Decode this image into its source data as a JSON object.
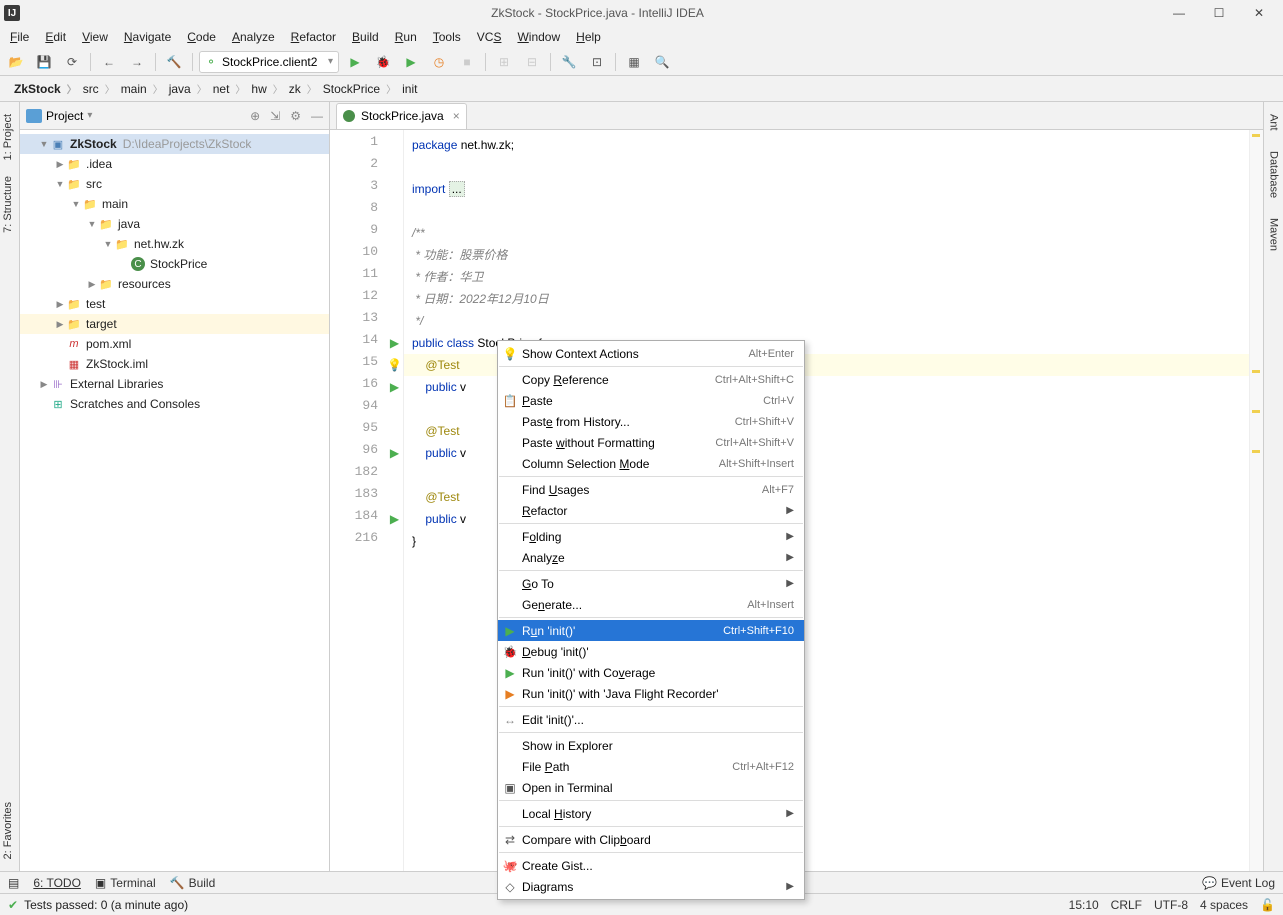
{
  "window": {
    "title": "ZkStock - StockPrice.java - IntelliJ IDEA"
  },
  "menu": [
    "File",
    "Edit",
    "View",
    "Navigate",
    "Code",
    "Analyze",
    "Refactor",
    "Build",
    "Run",
    "Tools",
    "VCS",
    "Window",
    "Help"
  ],
  "menu_u": [
    "F",
    "E",
    "V",
    "N",
    "C",
    "A",
    "R",
    "B",
    "R",
    "T",
    "S",
    "W",
    "H"
  ],
  "run_config": "StockPrice.client2",
  "breadcrumbs": [
    "ZkStock",
    "src",
    "main",
    "java",
    "net",
    "hw",
    "zk",
    "StockPrice",
    "init"
  ],
  "project_panel": {
    "title": "Project"
  },
  "tree": [
    {
      "indent": 0,
      "arrow": "▼",
      "icon": "module",
      "label": "ZkStock",
      "bold": true,
      "path": "D:\\IdeaProjects\\ZkStock",
      "selected": true
    },
    {
      "indent": 1,
      "arrow": "▶",
      "icon": "folder",
      "label": ".idea"
    },
    {
      "indent": 1,
      "arrow": "▼",
      "icon": "folder",
      "label": "src"
    },
    {
      "indent": 2,
      "arrow": "▼",
      "icon": "folder",
      "label": "main"
    },
    {
      "indent": 3,
      "arrow": "▼",
      "icon": "src-folder",
      "label": "java"
    },
    {
      "indent": 4,
      "arrow": "▼",
      "icon": "pkg",
      "label": "net.hw.zk"
    },
    {
      "indent": 5,
      "arrow": "",
      "icon": "class",
      "label": "StockPrice"
    },
    {
      "indent": 3,
      "arrow": "▶",
      "icon": "res",
      "label": "resources"
    },
    {
      "indent": 1,
      "arrow": "▶",
      "icon": "folder",
      "label": "test"
    },
    {
      "indent": 1,
      "arrow": "▶",
      "icon": "target",
      "label": "target",
      "target": true
    },
    {
      "indent": 1,
      "arrow": "",
      "icon": "maven",
      "label": "pom.xml"
    },
    {
      "indent": 1,
      "arrow": "",
      "icon": "iml",
      "label": "ZkStock.iml"
    },
    {
      "indent": 0,
      "arrow": "▶",
      "icon": "ext",
      "label": "External Libraries"
    },
    {
      "indent": 0,
      "arrow": "",
      "icon": "scr",
      "label": "Scratches and Consoles"
    }
  ],
  "tab": {
    "title": "StockPrice.java"
  },
  "code": {
    "line_numbers": [
      "1",
      "2",
      "3",
      "8",
      "9",
      "10",
      "11",
      "12",
      "13",
      "14",
      "15",
      "16",
      "94",
      "95",
      "96",
      "182",
      "183",
      "184",
      "216"
    ],
    "lines": [
      {
        "html": "<span class='kw'>package</span> net.hw.zk;"
      },
      {
        "html": ""
      },
      {
        "html": "<span class='kw'>import</span> <span class='fold-bg'>...</span>"
      },
      {
        "html": ""
      },
      {
        "html": "<span class='cm'>/**</span>"
      },
      {
        "html": "<span class='cm'> * 功能：股票价格</span>"
      },
      {
        "html": "<span class='cm'> * 作者：华卫</span>"
      },
      {
        "html": "<span class='cm'> * 日期：2022年12月10日</span>"
      },
      {
        "html": "<span class='cm'> */</span>"
      },
      {
        "html": "<span class='kw'>public class</span> StockPrice {"
      },
      {
        "html": "    <span class='an'>@Test</span>",
        "hl": true
      },
      {
        "html": "    <span class='kw'>public</span> v"
      },
      {
        "html": ""
      },
      {
        "html": "    <span class='an'>@Test</span>"
      },
      {
        "html": "    <span class='kw'>public</span> v"
      },
      {
        "html": ""
      },
      {
        "html": "    <span class='an'>@Test</span>"
      },
      {
        "html": "    <span class='kw'>public</span> v"
      },
      {
        "html": "}"
      }
    ],
    "gutter_icons": {
      "2": "",
      "9": "run",
      "10": "bulb",
      "11": {
        "type": "run",
        "extra": "↓"
      },
      "14": "run",
      "17": "run"
    }
  },
  "context_menu": [
    {
      "icon": "💡",
      "label": "Show Context Actions",
      "short": "Alt+Enter"
    },
    {
      "sep": true
    },
    {
      "label": "Copy <u>R</u>eference",
      "short": "Ctrl+Alt+Shift+C"
    },
    {
      "icon": "📋",
      "label": "<u>P</u>aste",
      "short": "Ctrl+V"
    },
    {
      "label": "Past<u>e</u> from History...",
      "short": "Ctrl+Shift+V"
    },
    {
      "label": "Paste <u>w</u>ithout Formatting",
      "short": "Ctrl+Alt+Shift+V"
    },
    {
      "label": "Column Selection <u>M</u>ode",
      "short": "Alt+Shift+Insert"
    },
    {
      "sep": true
    },
    {
      "label": "Find <u>U</u>sages",
      "short": "Alt+F7"
    },
    {
      "label": "<u>R</u>efactor",
      "arrow": true
    },
    {
      "sep": true
    },
    {
      "label": "F<u>o</u>lding",
      "arrow": true
    },
    {
      "label": "Analy<u>z</u>e",
      "arrow": true
    },
    {
      "sep": true
    },
    {
      "label": "<u>G</u>o To",
      "arrow": true
    },
    {
      "label": "Ge<u>n</u>erate...",
      "short": "Alt+Insert"
    },
    {
      "sep": true
    },
    {
      "icon": "▶",
      "iconColor": "#4caf50",
      "label": "R<u>u</u>n 'init()'",
      "short": "Ctrl+Shift+F10",
      "selected": true
    },
    {
      "icon": "🐞",
      "iconColor": "#4caf50",
      "label": "<u>D</u>ebug 'init()'"
    },
    {
      "icon": "▶",
      "iconColor": "#4caf50",
      "label": "Run 'init()' with Co<u>v</u>erage"
    },
    {
      "icon": "▶",
      "iconColor": "#e67e22",
      "label": "Run 'init()' with 'Java Flight Recorder'"
    },
    {
      "sep": true
    },
    {
      "icon": "↔",
      "iconColor": "#888",
      "label": "Edit 'init()'..."
    },
    {
      "sep": true
    },
    {
      "label": "Show in Explorer"
    },
    {
      "label": "File <u>P</u>ath",
      "short": "Ctrl+Alt+F12"
    },
    {
      "icon": "▣",
      "label": "Open in Terminal"
    },
    {
      "sep": true
    },
    {
      "label": "Local <u>H</u>istory",
      "arrow": true
    },
    {
      "sep": true
    },
    {
      "icon": "⇄",
      "label": "Compare with Clip<u>b</u>oard"
    },
    {
      "sep": true
    },
    {
      "icon": "🐙",
      "label": "Create Gist..."
    },
    {
      "icon": "◇",
      "label": "Diagrams",
      "arrow": true
    }
  ],
  "bottom_bar": {
    "todo": "6: TODO",
    "terminal": "Terminal",
    "build": "Build",
    "event_log": "Event Log"
  },
  "status_bar": {
    "tests": "Tests passed: 0 (a minute ago)",
    "pos": "15:10",
    "sep": "CRLF",
    "enc": "UTF-8",
    "spaces": "4 spaces"
  },
  "left_tools": {
    "project": "1: Project",
    "structure": "7: Structure",
    "favorites": "2: Favorites"
  },
  "right_tools": {
    "ant": "Ant",
    "database": "Database",
    "maven": "Maven"
  }
}
